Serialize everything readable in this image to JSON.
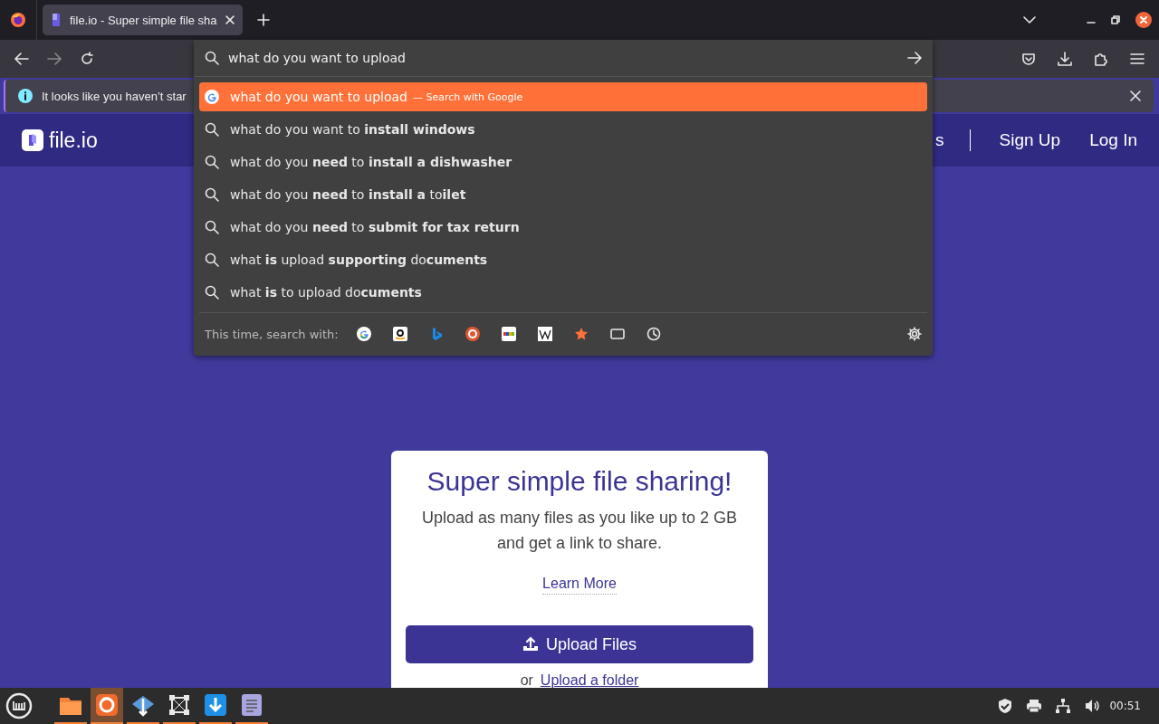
{
  "browser": {
    "tabs": [
      {
        "title": "file.io - Super simple file sha",
        "selected": true
      }
    ],
    "url_input": {
      "value": "what do you want to upload"
    },
    "notification": {
      "text": "It looks like you haven’t star"
    },
    "url_popup": {
      "suggestions": [
        {
          "kind": "engine",
          "text": "what do you want to upload",
          "note": "— Search with Google",
          "selected": true
        },
        {
          "kind": "search",
          "text": "what do you want to **install windows**",
          "selected": false
        },
        {
          "kind": "search",
          "text": "what do you **need** to **install a dishwasher**",
          "selected": false
        },
        {
          "kind": "search",
          "text": "what do you **need** to **install a** to**ilet**",
          "selected": false
        },
        {
          "kind": "search",
          "text": "what do you **need** to **submit for tax return**",
          "selected": false
        },
        {
          "kind": "search",
          "text": "what **is** upload **supporting** do**cuments**",
          "selected": false
        },
        {
          "kind": "search",
          "text": "what **is** to upload do**cuments**",
          "selected": false
        }
      ],
      "search_with_label": "This time, search with:"
    }
  },
  "site": {
    "logo": "file.io",
    "nav_links": [
      {
        "text": "s"
      },
      {
        "text": "Sign Up"
      },
      {
        "text": "Log In"
      }
    ],
    "card": {
      "title": "Super simple file sharing!",
      "description": "Upload as many files as you like up to 2 GB and get a link to share.",
      "learn_more": "Learn More",
      "upload_button": "Upload Files",
      "folder_prefix": "or",
      "folder_link": "Upload a folder"
    }
  },
  "taskbar": {
    "apps": [
      {
        "kind": "folder",
        "selected": false
      },
      {
        "kind": "firefox",
        "selected": true
      },
      {
        "kind": "network",
        "selected": false
      },
      {
        "kind": "frame",
        "selected": false
      },
      {
        "kind": "download",
        "selected": false
      },
      {
        "kind": "notes",
        "selected": false
      }
    ],
    "clock": "00:51"
  }
}
